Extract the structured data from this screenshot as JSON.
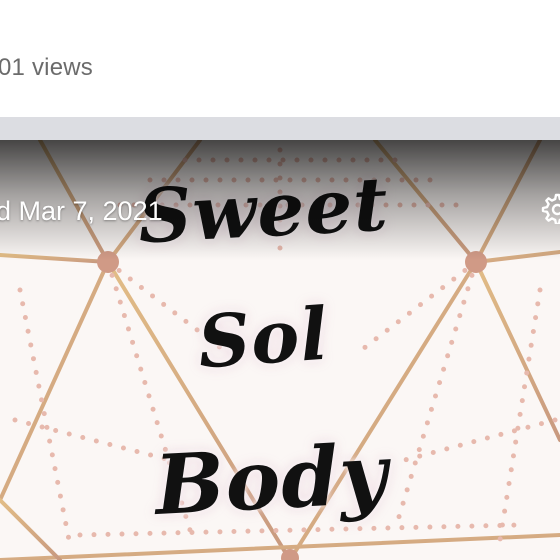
{
  "post": {
    "views_text": "01 views",
    "date_text": "d Mar 7, 2021"
  },
  "media": {
    "logo_lines": [
      "Sweet",
      "Sol",
      "Body"
    ],
    "colors": {
      "line_gold": "#d8b07a",
      "line_rose": "#c89a7d",
      "dot_pink": "#e7b9ad",
      "node": "#d09a86",
      "background": "#fbf7f5"
    }
  },
  "icons": {
    "settings": "gear-icon"
  }
}
